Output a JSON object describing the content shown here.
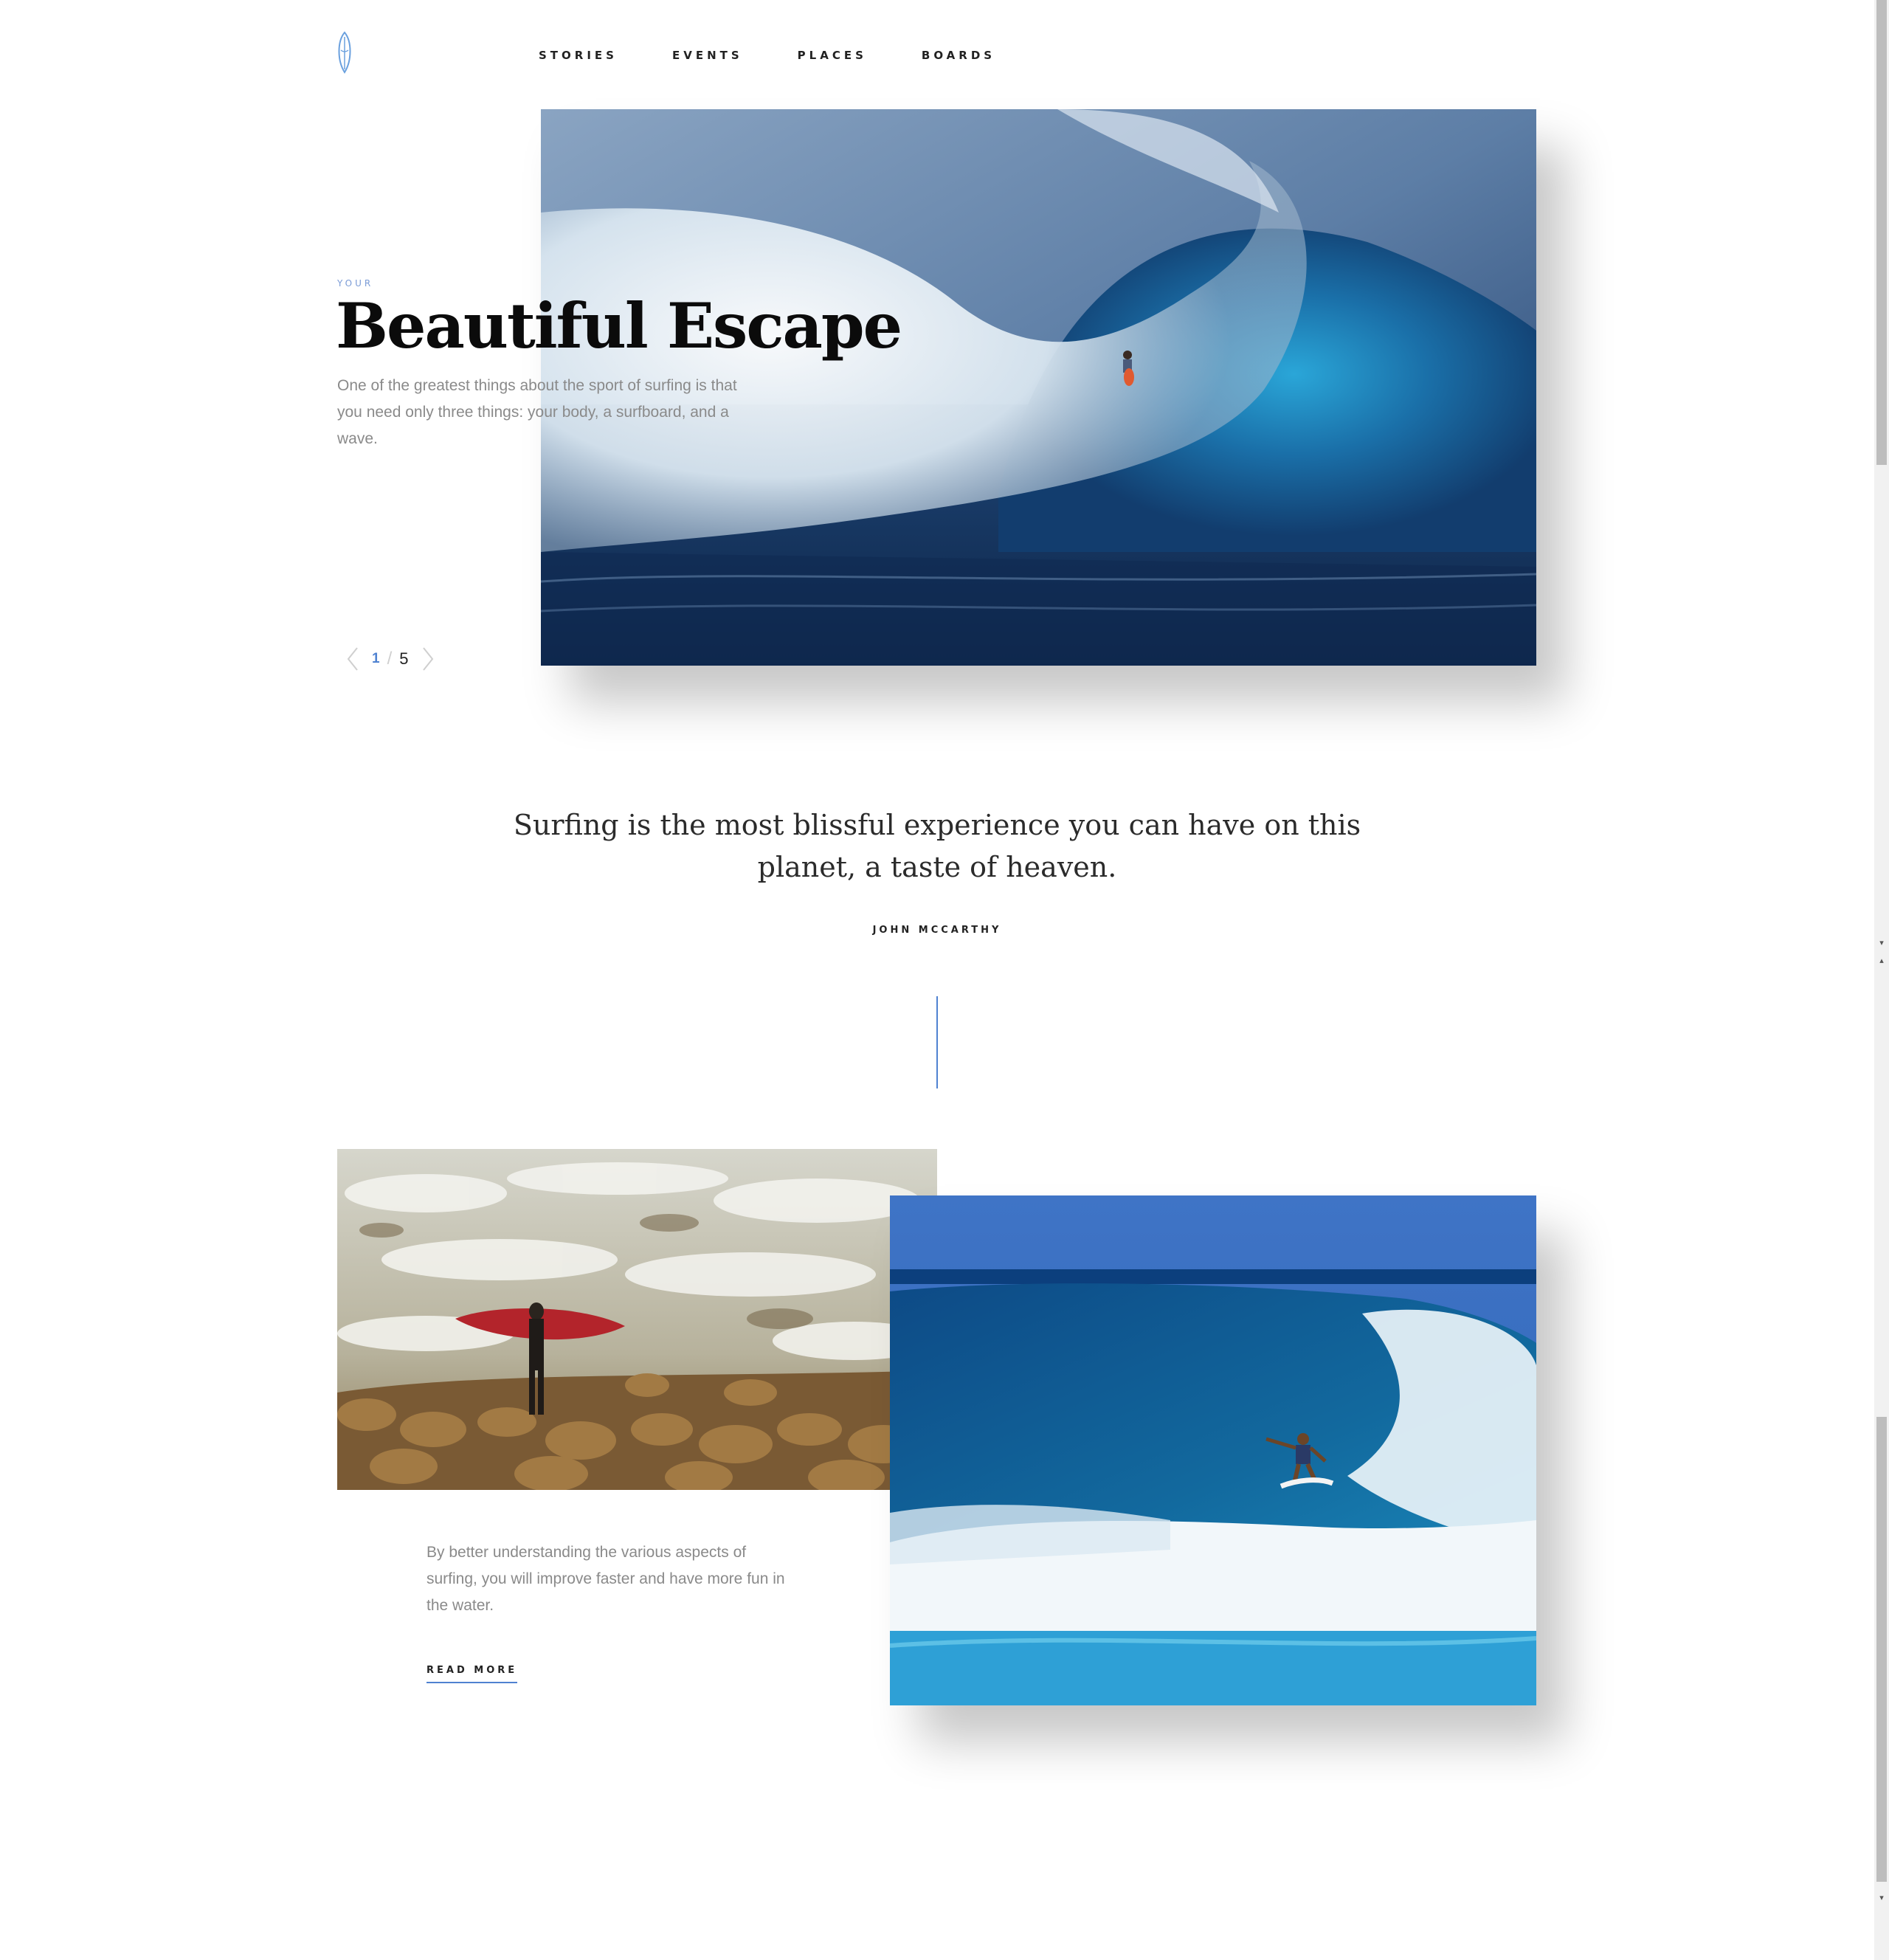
{
  "header": {
    "logo": "surfboard-logo-icon",
    "nav": [
      {
        "label": "STORIES"
      },
      {
        "label": "EVENTS"
      },
      {
        "label": "PLACES"
      },
      {
        "label": "BOARDS"
      }
    ]
  },
  "hero": {
    "eyebrow": "YOUR",
    "title": "Beautiful Escape",
    "text": "One of the greatest things about the sport of surfing is that you need only three things: your body, a surfboard, and a wave.",
    "image": "big-wave-surfer-photo",
    "pager": {
      "current": "1",
      "separator": "/",
      "total": "5"
    }
  },
  "quote": {
    "text": "Surfing is the most blissful experience you can have on this planet, a taste of heaven.",
    "author": "JOHN MCCARTHY"
  },
  "feature": {
    "image_a": "surfer-on-rocks-photo",
    "image_b": "surfer-in-barrel-photo",
    "text": "By better understanding the various aspects of surfing, you will improve faster and have more fun in the water.",
    "read_more": "READ MORE"
  },
  "colors": {
    "accent": "#4f82d1",
    "body_text": "#8a8a8a",
    "title_text": "#0b0b0b"
  }
}
